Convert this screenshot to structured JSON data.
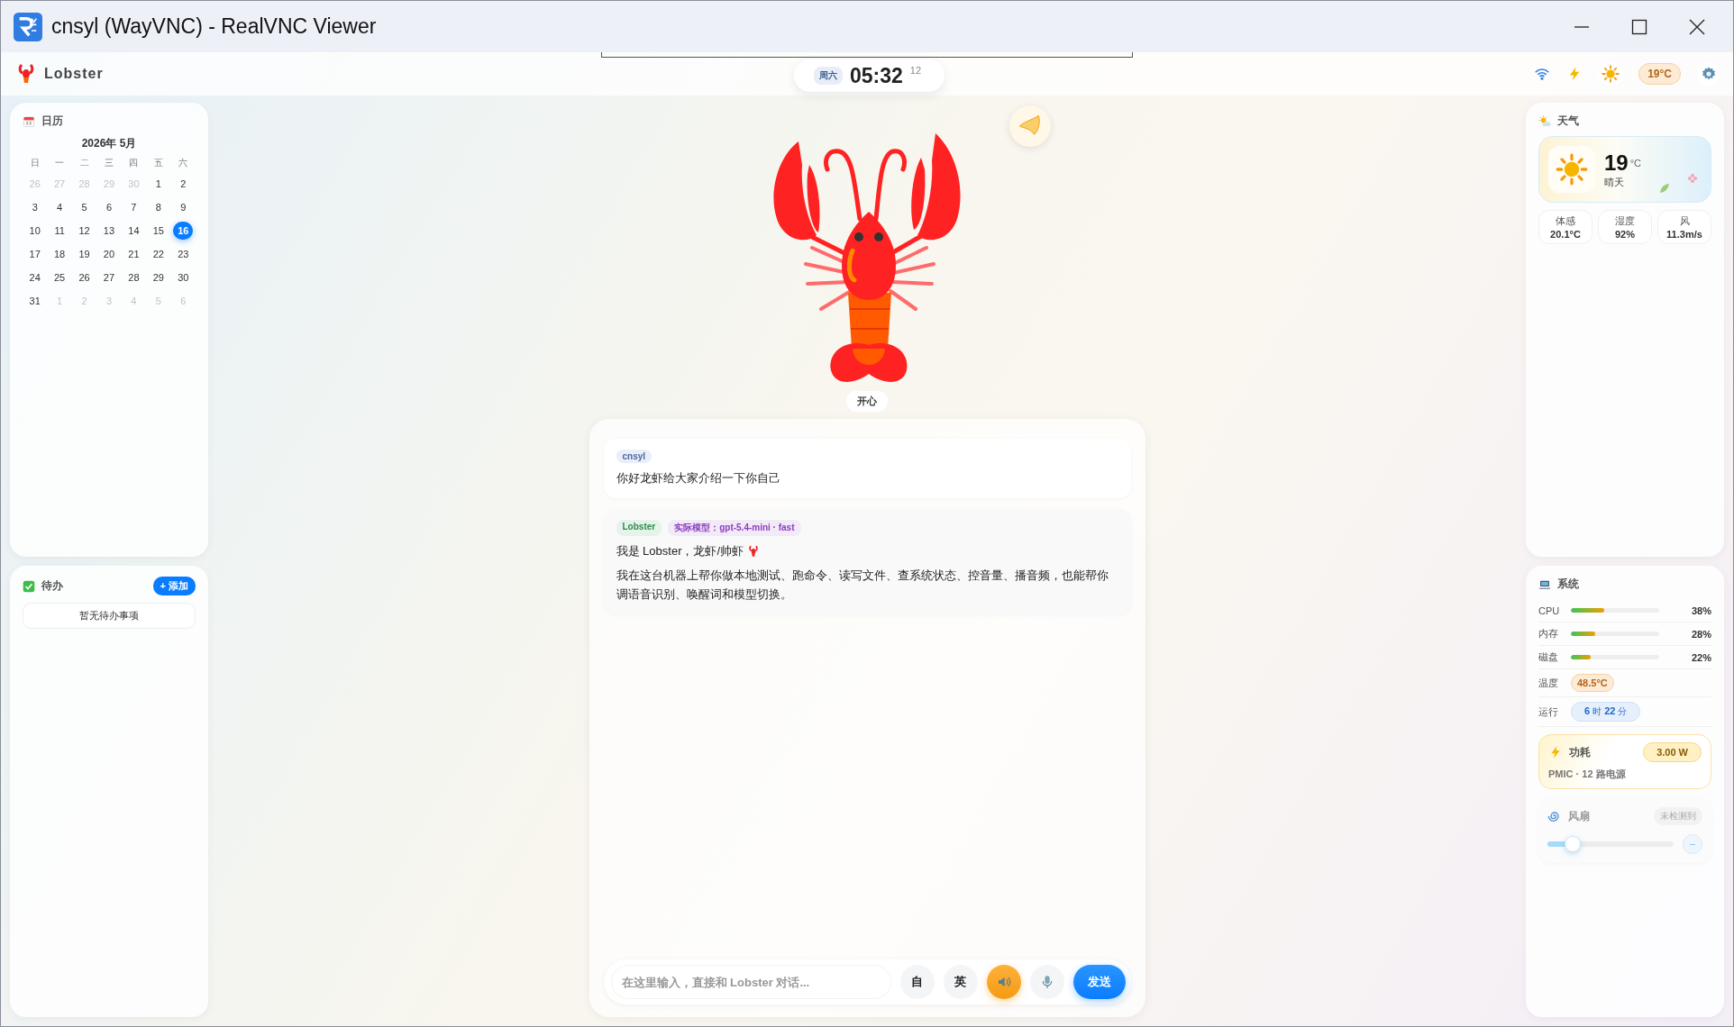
{
  "window": {
    "title": "cnsyl (WayVNC) - RealVNC Viewer"
  },
  "header": {
    "app_name": "Lobster",
    "day": "周六",
    "time": "05:32",
    "seconds": "12",
    "temperature": "19°C"
  },
  "calendar": {
    "title": "日历",
    "month": "2026年 5月",
    "weekdays": [
      "日",
      "一",
      "二",
      "三",
      "四",
      "五",
      "六"
    ],
    "days": [
      {
        "label": "26",
        "muted": true,
        "selected": false
      },
      {
        "label": "27",
        "muted": true,
        "selected": false
      },
      {
        "label": "28",
        "muted": true,
        "selected": false
      },
      {
        "label": "29",
        "muted": true,
        "selected": false
      },
      {
        "label": "30",
        "muted": true,
        "selected": false
      },
      {
        "label": "1",
        "muted": false,
        "selected": false
      },
      {
        "label": "2",
        "muted": false,
        "selected": false
      },
      {
        "label": "3",
        "muted": false,
        "selected": false
      },
      {
        "label": "4",
        "muted": false,
        "selected": false
      },
      {
        "label": "5",
        "muted": false,
        "selected": false
      },
      {
        "label": "6",
        "muted": false,
        "selected": false
      },
      {
        "label": "7",
        "muted": false,
        "selected": false
      },
      {
        "label": "8",
        "muted": false,
        "selected": false
      },
      {
        "label": "9",
        "muted": false,
        "selected": false
      },
      {
        "label": "10",
        "muted": false,
        "selected": false
      },
      {
        "label": "11",
        "muted": false,
        "selected": false
      },
      {
        "label": "12",
        "muted": false,
        "selected": false
      },
      {
        "label": "13",
        "muted": false,
        "selected": false
      },
      {
        "label": "14",
        "muted": false,
        "selected": false
      },
      {
        "label": "15",
        "muted": false,
        "selected": false
      },
      {
        "label": "16",
        "muted": false,
        "selected": true
      },
      {
        "label": "17",
        "muted": false,
        "selected": false
      },
      {
        "label": "18",
        "muted": false,
        "selected": false
      },
      {
        "label": "19",
        "muted": false,
        "selected": false
      },
      {
        "label": "20",
        "muted": false,
        "selected": false
      },
      {
        "label": "21",
        "muted": false,
        "selected": false
      },
      {
        "label": "22",
        "muted": false,
        "selected": false
      },
      {
        "label": "23",
        "muted": false,
        "selected": false
      },
      {
        "label": "24",
        "muted": false,
        "selected": false
      },
      {
        "label": "25",
        "muted": false,
        "selected": false
      },
      {
        "label": "26",
        "muted": false,
        "selected": false
      },
      {
        "label": "27",
        "muted": false,
        "selected": false
      },
      {
        "label": "28",
        "muted": false,
        "selected": false
      },
      {
        "label": "29",
        "muted": false,
        "selected": false
      },
      {
        "label": "30",
        "muted": false,
        "selected": false
      },
      {
        "label": "31",
        "muted": false,
        "selected": false
      },
      {
        "label": "1",
        "muted": true,
        "selected": false
      },
      {
        "label": "2",
        "muted": true,
        "selected": false
      },
      {
        "label": "3",
        "muted": true,
        "selected": false
      },
      {
        "label": "4",
        "muted": true,
        "selected": false
      },
      {
        "label": "5",
        "muted": true,
        "selected": false
      },
      {
        "label": "6",
        "muted": true,
        "selected": false
      }
    ]
  },
  "todo": {
    "title": "待办",
    "add_button": "+ 添加",
    "empty": "暂无待办事项"
  },
  "mascot": {
    "mood": "开心"
  },
  "chat": {
    "messages": [
      {
        "kind": "user",
        "sender": "cnsyl",
        "lines": [
          "你好龙虾给大家介绍一下你自己"
        ]
      },
      {
        "kind": "bot",
        "sender": "Lobster",
        "model": "实际模型：gpt-5.4-mini · fast",
        "lines": [
          "我是 Lobster，龙虾/帅虾",
          "我在这台机器上帮你做本地测试、跑命令、读写文件、查系统状态、控音量、播音频，也能帮你调语音识别、唤醒词和模型切换。"
        ]
      }
    ],
    "input": {
      "placeholder": "在这里输入，直接和 Lobster 对话..."
    },
    "toggles": [
      {
        "label": "自"
      },
      {
        "label": "英"
      }
    ],
    "speaker": {
      "on": true
    },
    "mic": {
      "on": false
    },
    "send": "发送"
  },
  "weather": {
    "title": "天气",
    "temperature": "19",
    "unit": "°C",
    "condition": "晴天",
    "stats": [
      {
        "label": "体感",
        "value": "20.1°C"
      },
      {
        "label": "湿度",
        "value": "92%"
      },
      {
        "label": "风",
        "value": "11.3m/s"
      }
    ]
  },
  "system": {
    "title": "系统",
    "meters": [
      {
        "label": "CPU",
        "level": 0.38,
        "reading": "38%"
      },
      {
        "label": "内存",
        "level": 0.28,
        "reading": "28%"
      },
      {
        "label": "磁盘",
        "level": 0.22,
        "reading": "22%"
      }
    ],
    "temperature": {
      "label": "温度",
      "value": "48.5°C"
    },
    "uptime": {
      "label": "运行",
      "hours": "6",
      "hour_unit": "时",
      "minutes": "22",
      "minute_unit": "分"
    },
    "power": {
      "title": "功耗",
      "value": "3.00 W",
      "detail": "PMIC · 12 路电源"
    },
    "fan": {
      "title": "风扇",
      "status": "未检测到",
      "level": 0.2,
      "reading": "--",
      "disabled": true
    }
  }
}
